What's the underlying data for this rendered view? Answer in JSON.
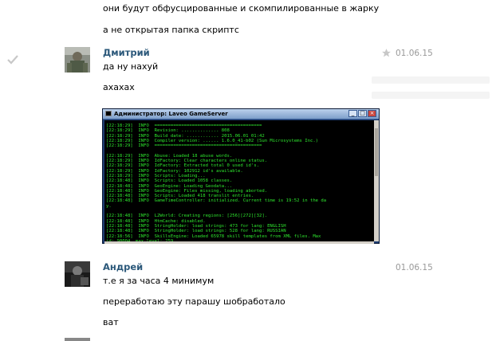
{
  "comments": [
    {
      "lines": [
        "они будут обфусцированные и скомпилированные в жарку",
        "а не открытая папка скриптс"
      ]
    },
    {
      "author": "Дмитрий",
      "date": "01.06.15",
      "lines": [
        "да ну нахуй",
        "ахахах"
      ]
    },
    {
      "author": "Андрей",
      "date": "01.06.15",
      "lines": [
        "т.е я за часа 4 минимум",
        "переработаю эту парашу шобработало",
        "ват"
      ]
    }
  ],
  "console": {
    "title": "Администратор: Laveo GameServer",
    "lines": [
      "[22:18:29]  INFO  ========================================",
      "[22:18:29]  INFO  Revision: .............. 808",
      "[22:18:29]  INFO  Build date: ............ 2015.06.01 01:42",
      "[22:18:29]  INFO  Compiler version: ...... 1.6.0_41-b02 (Sun Microsystems Inc.)",
      "[22:18:29]  INFO  ========================================",
      "",
      "[22:18:29]  INFO  Abuse: Loaded 18 abuse words.",
      "[22:18:29]  INFO  IdFactory: Clear characters online status.",
      "[22:18:29]  INFO  IdFactory: Extracted total 0 used id's.",
      "[22:18:29]  INFO  IdFactory: 102912 id's available.",
      "[22:18:29]  INFO  Scripts: Loading...",
      "[22:18:48]  INFO  Scripts: Loaded 1058 classes.",
      "[22:18:48]  INFO  GeoEngine: Loading Geodata...",
      "[22:18:48]  INFO  GeoEngine: Files missing, loading aborted.",
      "[22:18:48]  INFO  Scripts: Loaded 418 translit entries.",
      "[22:18:48]  INFO  GameTimeController: initialized. Current time is 19:52 in the da",
      "y.",
      "",
      "[22:18:48]  INFO  L2World: Creating regions: [256][272][32].",
      "[22:18:48]  INFO  HtmCache: disabled.",
      "[22:18:48]  INFO  StringHolder: load strings: 473 for lang: ENGLISH",
      "[22:18:48]  INFO  StringHolder: load strings: 528 for lang: RUSSIAN",
      "[22:18:56]  INFO  SkillsEngine: Loaded 65978 skill templates from XML files. Max",
      "id: 90004, max level: 259"
    ]
  },
  "colors": {
    "author": "#2b587a",
    "date": "#999999",
    "console_text": "#2ee62e",
    "console_bg": "#000000"
  },
  "icons": [
    "checkmark-icon",
    "star-icon",
    "minimize-icon",
    "maximize-icon",
    "close-icon",
    "console-icon"
  ]
}
